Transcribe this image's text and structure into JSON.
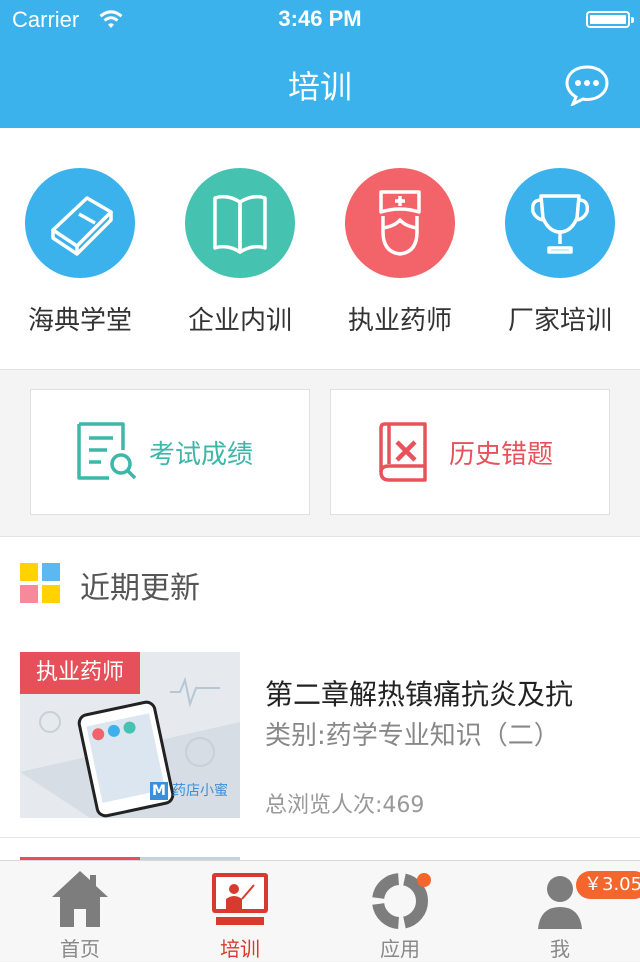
{
  "status": {
    "carrier": "Carrier",
    "time": "3:46 PM"
  },
  "nav": {
    "title": "培训"
  },
  "categories": [
    {
      "label": "海典学堂",
      "color": "#3bb2ec",
      "icon": "book-icon"
    },
    {
      "label": "企业内训",
      "color": "#45c2b0",
      "icon": "open-book-icon"
    },
    {
      "label": "执业药师",
      "color": "#f2636a",
      "icon": "nurse-icon"
    },
    {
      "label": "厂家培训",
      "color": "#3bb2ec",
      "icon": "trophy-icon"
    }
  ],
  "cards": [
    {
      "label": "考试成绩",
      "color": "#3cb7a8",
      "icon": "exam-result-icon"
    },
    {
      "label": "历史错题",
      "color": "#e8535b",
      "icon": "wrong-answer-book-icon"
    }
  ],
  "recent": {
    "title": "近期更新",
    "items": [
      {
        "tag": "执业药师",
        "brand_mark": "M",
        "brand": "药店小蜜",
        "title": "第二章解热镇痛抗炎及抗",
        "category": "类别:药学专业知识（二）",
        "views": "总浏览人次:469"
      }
    ]
  },
  "tabs": [
    {
      "label": "首页",
      "icon": "home-icon"
    },
    {
      "label": "培训",
      "icon": "training-icon",
      "active": true
    },
    {
      "label": "应用",
      "icon": "apps-icon"
    },
    {
      "label": "我",
      "icon": "user-icon",
      "badge": "￥3.05"
    }
  ],
  "colors": {
    "accent": "#3bb2ec",
    "tab_active": "#d73b2f",
    "badge": "#f4662b"
  }
}
